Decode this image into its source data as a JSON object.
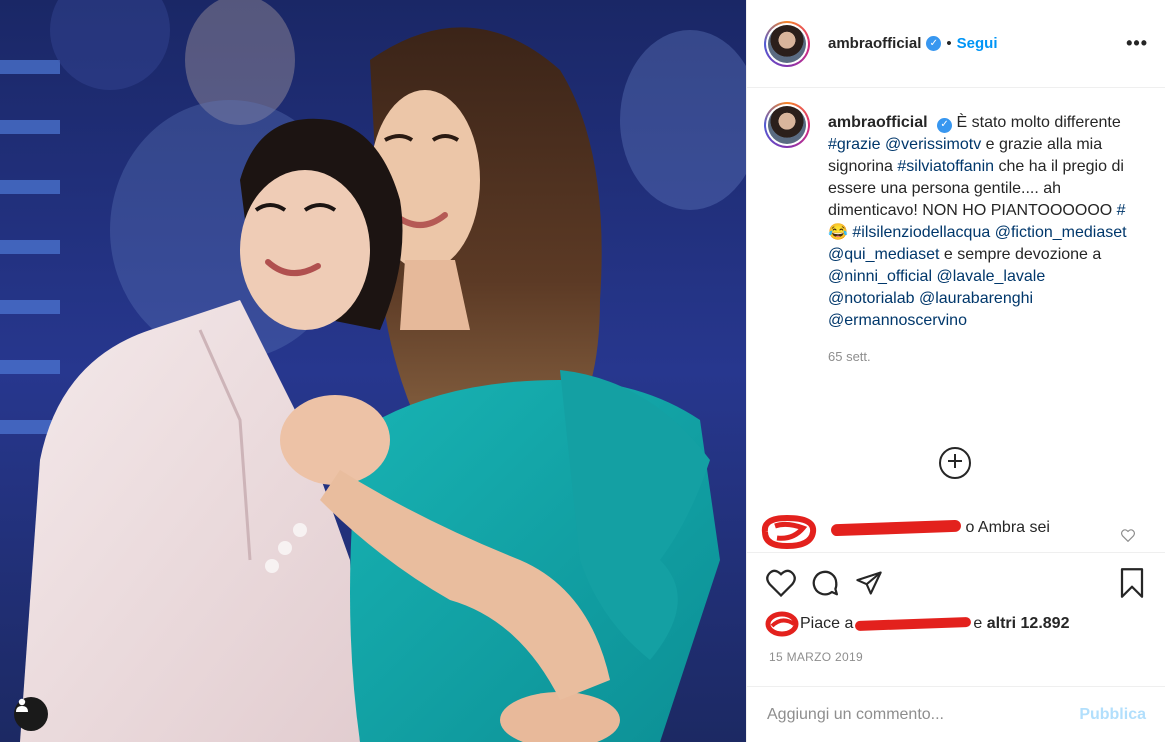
{
  "post": {
    "username": "ambraofficial",
    "verified": true,
    "follow_separator": "•",
    "follow_label": "Segui",
    "more_label": "•••",
    "caption": {
      "username": "ambraofficial",
      "text_1": "È stato molto differente ",
      "tag_1": "#grazie",
      "text_2": " ",
      "tag_2": "@verissimotv",
      "text_3": " e grazie alla mia signorina ",
      "tag_3": "#silviatoffanin",
      "text_4": " che ha il pregio di essere una persona gentile.... ah dimenticavo! NON HO PIANTOOOOOO ",
      "tag_4": "#😂",
      "text_5": " ",
      "tag_5": "#ilsilenziodellacqua",
      "text_6": " ",
      "tag_6": "@fiction_mediaset",
      "text_7": " ",
      "tag_7": "@qui_mediaset",
      "text_8": " e sempre devozione a ",
      "tag_8": "@ninni_official",
      "text_9": " ",
      "tag_9": "@lavale_lavale",
      "text_10": " ",
      "tag_10": "@notorialab",
      "text_11": " ",
      "tag_11": "@laurabarenghi",
      "text_12": " ",
      "tag_12": "@ermannoscervino"
    },
    "time_ago": "65 sett.",
    "comment": {
      "text": "o Ambra sei"
    },
    "likes": {
      "prefix": "Piace a",
      "suffix": "e",
      "others": "altri 12.892"
    },
    "date": "15 MARZO 2019",
    "comment_input": {
      "placeholder": "Aggiungi un commento..."
    },
    "publish_label": "Pubblica"
  },
  "colors": {
    "accent": "#0095f6",
    "verified": "#3897f0",
    "link": "#00376b",
    "muted": "#8e8e8e",
    "publish_disabled": "#b2dffc",
    "redaction": "#e3211d",
    "dress_teal": "#13a7a9"
  },
  "icons": [
    "user-tag-icon",
    "verified-icon",
    "more-icon",
    "add-circle-icon",
    "heart-icon",
    "comment-icon",
    "share-icon",
    "bookmark-icon"
  ]
}
